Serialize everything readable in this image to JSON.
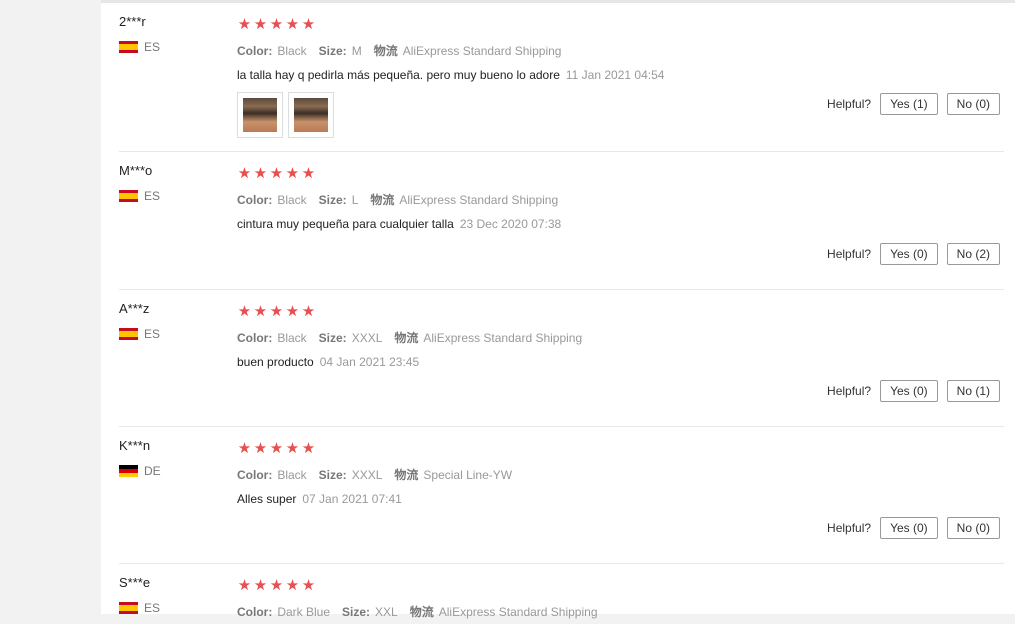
{
  "labels": {
    "color": "Color:",
    "size": "Size:",
    "shipping": "物流",
    "helpful": "Helpful?"
  },
  "star_color": "#e85050",
  "reviews": [
    {
      "user": "2***r",
      "country": "ES",
      "color": "Black",
      "size": "M",
      "shipping": "AliExpress Standard Shipping",
      "text": "la talla hay q pedirla más pequeña. pero muy bueno lo adore",
      "date": "11 Jan 2021 04:54",
      "yes": "Yes (1)",
      "no": "No (0)",
      "rating": 5
    },
    {
      "user": "M***o",
      "country": "ES",
      "color": "Black",
      "size": "L",
      "shipping": "AliExpress Standard Shipping",
      "text": "cintura muy pequeña para cualquier talla",
      "date": "23 Dec 2020 07:38",
      "yes": "Yes (0)",
      "no": "No (2)",
      "rating": 5
    },
    {
      "user": "A***z",
      "country": "ES",
      "color": "Black",
      "size": "XXXL",
      "shipping": "AliExpress Standard Shipping",
      "text": "buen producto",
      "date": "04 Jan 2021 23:45",
      "yes": "Yes (0)",
      "no": "No (1)",
      "rating": 5
    },
    {
      "user": "K***n",
      "country": "DE",
      "color": "Black",
      "size": "XXXL",
      "shipping": "Special Line-YW",
      "text": "Alles super",
      "date": "07 Jan 2021 07:41",
      "yes": "Yes (0)",
      "no": "No (0)",
      "rating": 5
    },
    {
      "user": "S***e",
      "country": "ES",
      "color": "Dark Blue",
      "size": "XXL",
      "shipping": "AliExpress Standard Shipping",
      "rating": 5
    }
  ]
}
